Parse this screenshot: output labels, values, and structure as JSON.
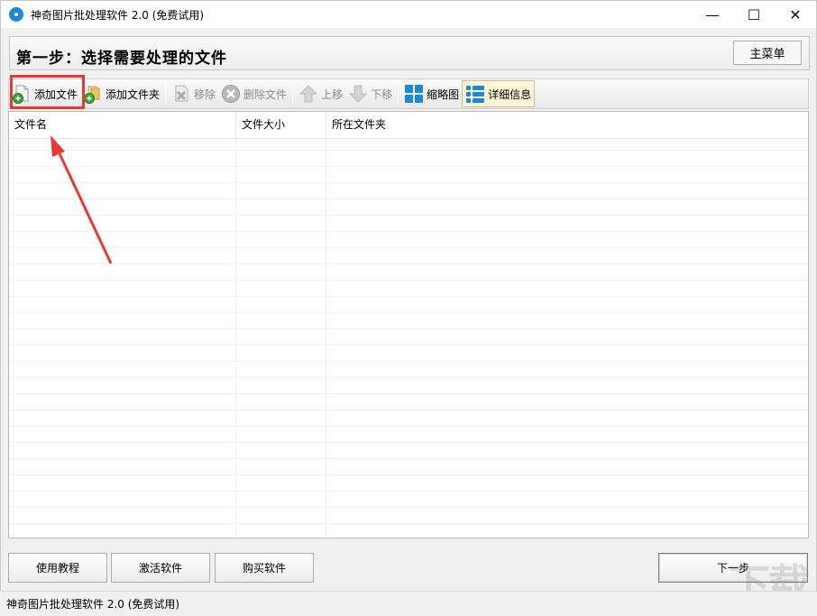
{
  "window": {
    "title": "神奇图片批处理软件 2.0 (免费试用)",
    "minimize_label": "—",
    "maximize_label": "☐",
    "close_label": "✕"
  },
  "step_header": {
    "title": "第一步：选择需要处理的文件",
    "main_menu_label": "主菜单"
  },
  "toolbar": {
    "add_file": "添加文件",
    "add_folder": "添加文件夹",
    "remove": "移除",
    "delete_file": "删除文件",
    "move_up": "上移",
    "move_down": "下移",
    "thumbnail": "缩略图",
    "details": "详细信息"
  },
  "table": {
    "columns": [
      "文件名",
      "文件大小",
      "所在文件夹"
    ]
  },
  "bottom": {
    "tutorial": "使用教程",
    "activate": "激活软件",
    "buy": "购买软件",
    "next": "下一步"
  },
  "statusbar": {
    "text": "神奇图片批处理软件 2.0 (免费试用)"
  },
  "colors": {
    "highlight": "#e53935",
    "accent_blue": "#1a8ad8"
  }
}
